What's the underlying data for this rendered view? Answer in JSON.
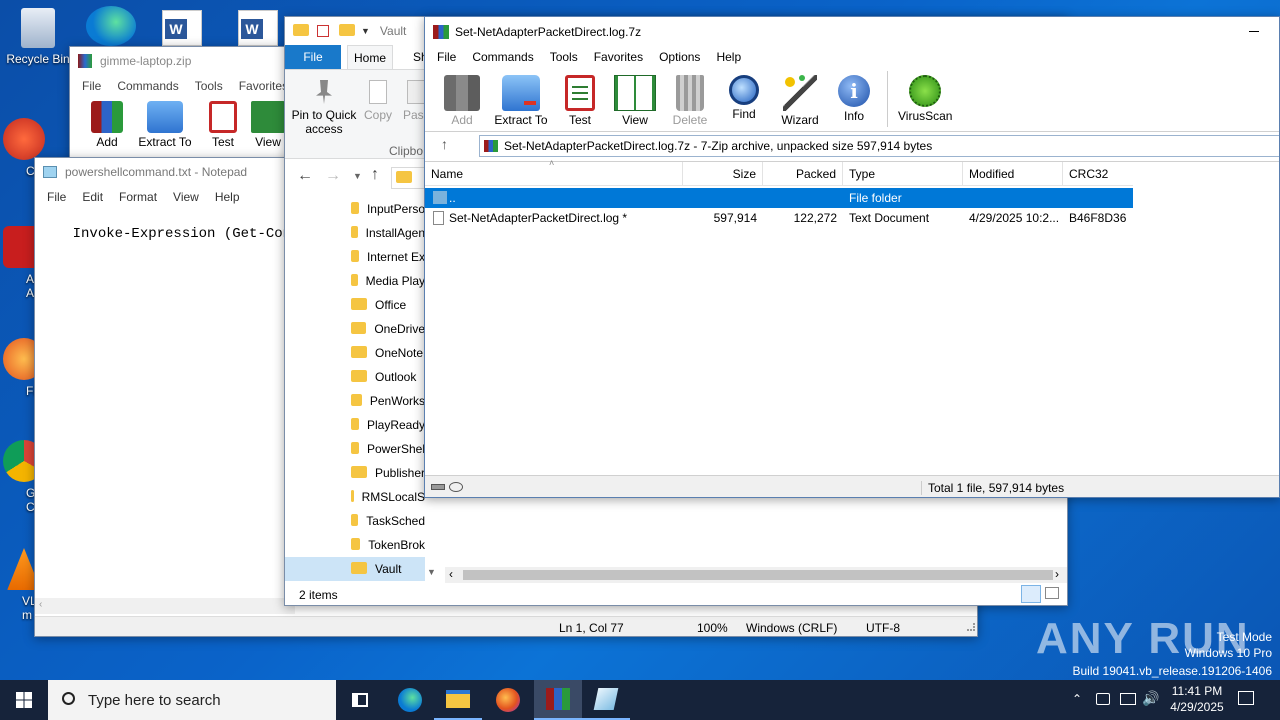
{
  "desktop": {
    "icons": [
      {
        "label": "Recycle Bin"
      },
      {
        "label": "CCle"
      },
      {
        "label": "Ad Acr"
      },
      {
        "label": "Fire"
      },
      {
        "label": "Goo Chr"
      },
      {
        "label": "VLC m pla"
      }
    ],
    "watermark": {
      "brand": "ANY RUN",
      "line1": "Test Mode",
      "line2": "Windows 10 Pro",
      "line3": "Build 19041.vb_release.191206-1406"
    }
  },
  "winrar_back": {
    "title": "gimme-laptop.zip",
    "menu": [
      "File",
      "Commands",
      "Tools",
      "Favorites"
    ],
    "tools": [
      "Add",
      "Extract To",
      "Test",
      "View"
    ]
  },
  "notepad": {
    "title": "powershellcommand.txt - Notepad",
    "menu": [
      "File",
      "Edit",
      "Format",
      "View",
      "Help"
    ],
    "content": "Invoke-Expression (Get-Content",
    "status": {
      "position": "Ln 1, Col 77",
      "zoom": "100%",
      "eol": "Windows (CRLF)",
      "encoding": "UTF-8"
    }
  },
  "explorer": {
    "title": "Vault",
    "tabs": [
      "File",
      "Home",
      "Sh"
    ],
    "ribbon": {
      "pin": "Pin to Quick access",
      "copy": "Copy",
      "paste": "Pas",
      "group": "Clipbo"
    },
    "folders": [
      "InputPerso",
      "InstallAgen",
      "Internet Ex",
      "Media Play",
      "Office",
      "OneDrive",
      "OneNote",
      "Outlook",
      "PenWorks",
      "PlayReady",
      "PowerShel",
      "Publisher",
      "RMSLocalS",
      "TaskSched",
      "TokenBrok",
      "Vault"
    ],
    "status": "2 items"
  },
  "winrar": {
    "title": "Set-NetAdapterPacketDirect.log.7z",
    "menu": [
      "File",
      "Commands",
      "Tools",
      "Favorites",
      "Options",
      "Help"
    ],
    "tools": [
      {
        "label": "Add",
        "icon": "add-archive-icon",
        "disabled": true
      },
      {
        "label": "Extract To",
        "icon": "extract-folder-icon",
        "disabled": false
      },
      {
        "label": "Test",
        "icon": "test-clipboard-icon",
        "disabled": false
      },
      {
        "label": "View",
        "icon": "book-icon",
        "disabled": false
      },
      {
        "label": "Delete",
        "icon": "trash-icon",
        "disabled": true
      },
      {
        "label": "Find",
        "icon": "magnifier-icon",
        "disabled": false
      },
      {
        "label": "Wizard",
        "icon": "wand-icon",
        "disabled": false
      },
      {
        "label": "Info",
        "icon": "info-icon",
        "disabled": false
      },
      {
        "label": "VirusScan",
        "icon": "virus-icon",
        "disabled": false
      }
    ],
    "path": "Set-NetAdapterPacketDirect.log.7z - 7-Zip archive, unpacked size 597,914 bytes",
    "columns": [
      "Name",
      "Size",
      "Packed",
      "Type",
      "Modified",
      "CRC32"
    ],
    "rows": [
      {
        "name": "..",
        "size": "",
        "packed": "",
        "type": "File folder",
        "modified": "",
        "crc": ""
      },
      {
        "name": "Set-NetAdapterPacketDirect.log *",
        "size": "597,914",
        "packed": "122,272",
        "type": "Text Document",
        "modified": "4/29/2025 10:2...",
        "crc": "B46F8D36"
      }
    ],
    "status": "Total 1 file, 597,914 bytes"
  },
  "taskbar": {
    "search_placeholder": "Type here to search",
    "time": "11:41 PM",
    "date": "4/29/2025"
  },
  "colors": {
    "accent": "#0078d7",
    "selection": "#0078d7",
    "taskbar": "#16233a"
  }
}
